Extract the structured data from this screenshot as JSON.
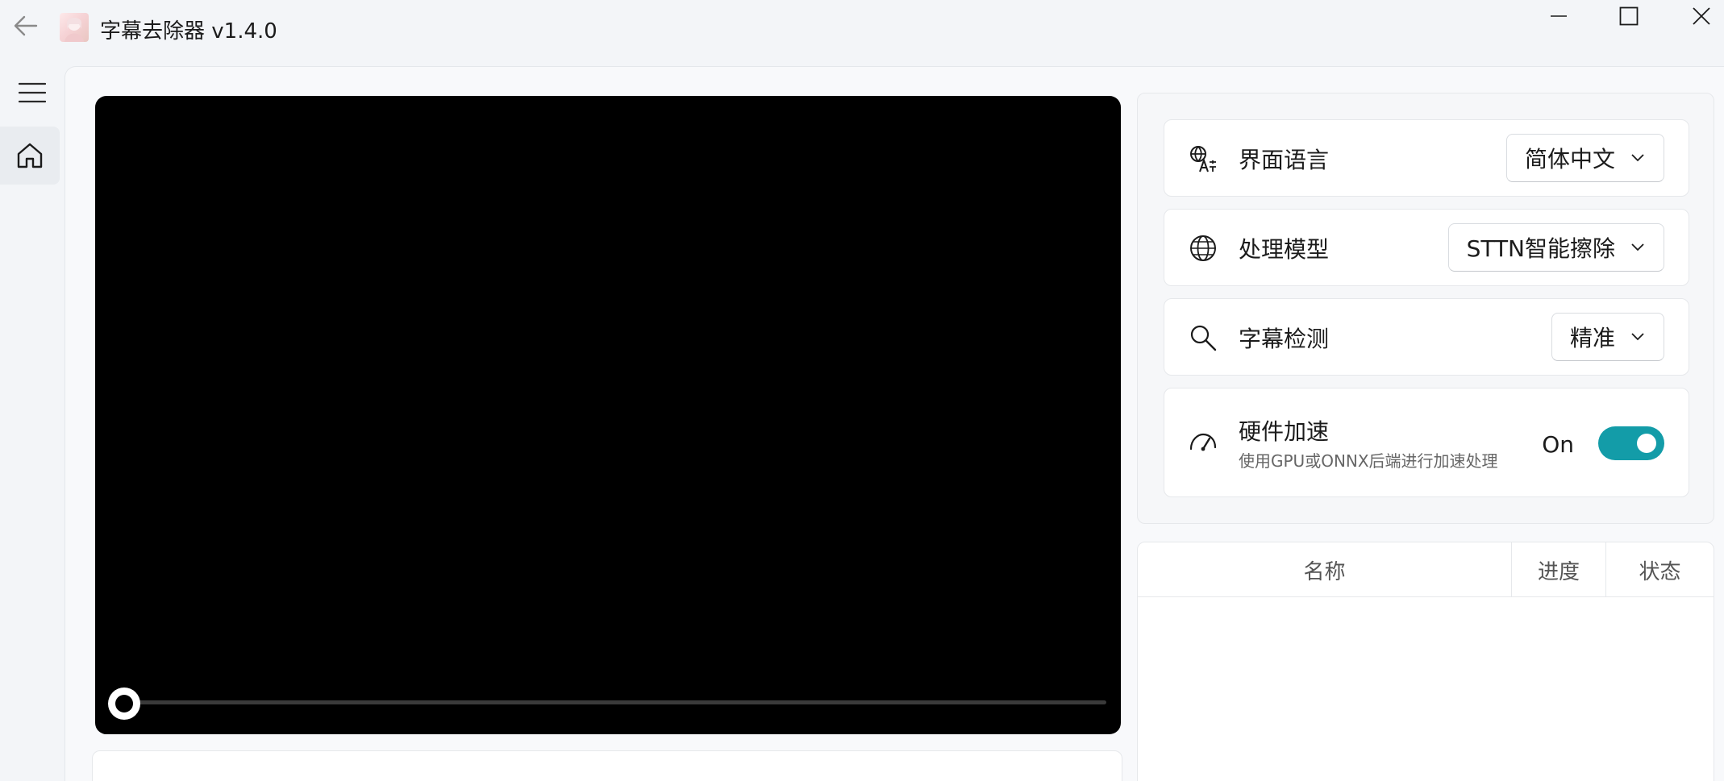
{
  "titlebar": {
    "title": "字幕去除器 v1.4.0"
  },
  "sidebar": {
    "items": [
      {
        "name": "home",
        "icon": "home-icon"
      }
    ]
  },
  "settings": {
    "language": {
      "label": "界面语言",
      "value": "简体中文",
      "icon": "translate-icon"
    },
    "model": {
      "label": "处理模型",
      "value": "STTN智能擦除",
      "icon": "globe-icon"
    },
    "detection": {
      "label": "字幕检测",
      "value": "精准",
      "icon": "search-icon"
    },
    "hardware": {
      "label": "硬件加速",
      "description": "使用GPU或ONNX后端进行加速处理",
      "state_label": "On",
      "enabled": true,
      "icon": "speedometer-icon"
    }
  },
  "player": {
    "progress": 0
  },
  "task_table": {
    "columns": [
      "名称",
      "进度",
      "状态"
    ],
    "rows": []
  },
  "colors": {
    "accent": "#139ca8",
    "video_bg": "#000000",
    "window_bg": "#f3f5f8"
  }
}
